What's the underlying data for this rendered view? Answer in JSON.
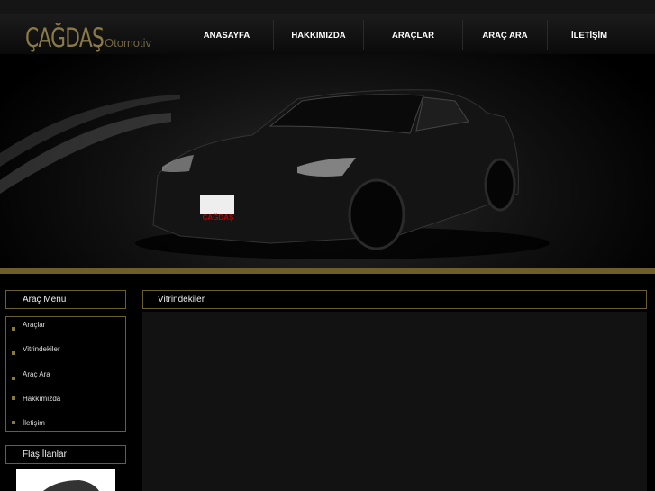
{
  "brand": {
    "name": "ÇAĞDAŞ",
    "sub": "Otomotiv",
    "plate": "ÇAĞDAŞ"
  },
  "nav": [
    {
      "label": "ANASAYFA"
    },
    {
      "label": "HAKKIMIZDA"
    },
    {
      "label": "ARAÇLAR"
    },
    {
      "label": "ARAÇ ARA"
    },
    {
      "label": "İLETİŞİM"
    }
  ],
  "sidebar": {
    "menu_title": "Araç Menü",
    "menu": [
      {
        "label": "Araçlar"
      },
      {
        "label": "Vitrindekiler"
      },
      {
        "label": "Araç Ara"
      },
      {
        "label": "Hakkımızda"
      },
      {
        "label": "İletişim"
      }
    ],
    "flash_title": "Flaş İlanlar"
  },
  "main": {
    "title": "Vitrindekiler"
  },
  "colors": {
    "gold": "#6d5f2b",
    "bullet": "#8a7a3a"
  }
}
